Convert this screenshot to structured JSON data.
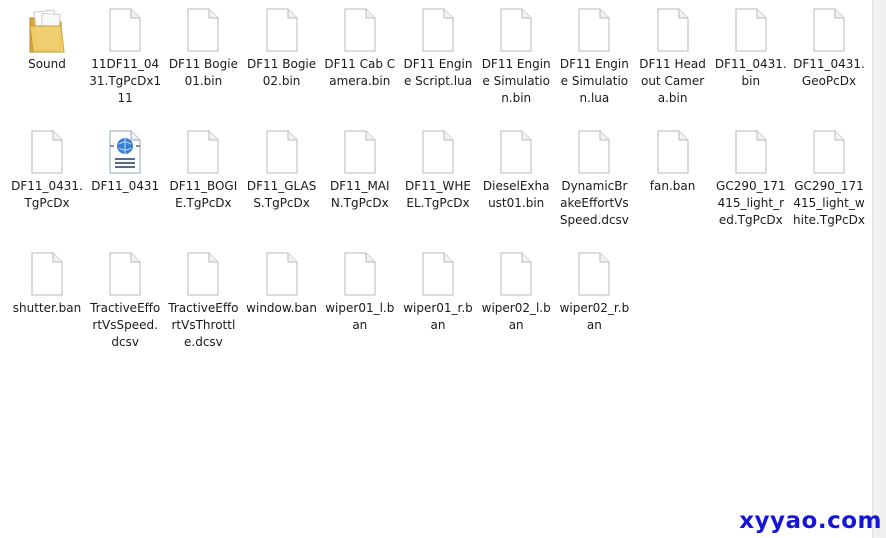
{
  "files": [
    {
      "label": "Sound",
      "type": "folder"
    },
    {
      "label": "11DF11_0431.TgPcDx111",
      "type": "file"
    },
    {
      "label": "DF11 Bogie01.bin",
      "type": "file"
    },
    {
      "label": "DF11 Bogie02.bin",
      "type": "file"
    },
    {
      "label": "DF11 Cab Camera.bin",
      "type": "file"
    },
    {
      "label": "DF11 Engine Script.lua",
      "type": "file"
    },
    {
      "label": "DF11 Engine Simulation.bin",
      "type": "file"
    },
    {
      "label": "DF11 Engine Simulation.lua",
      "type": "file"
    },
    {
      "label": "DF11 Headout Camera.bin",
      "type": "file"
    },
    {
      "label": "DF11_0431.bin",
      "type": "file"
    },
    {
      "label": "DF11_0431.GeoPcDx",
      "type": "file"
    },
    {
      "label": "DF11_0431.TgPcDx",
      "type": "file"
    },
    {
      "label": "DF11_0431",
      "type": "html"
    },
    {
      "label": "DF11_BOGIE.TgPcDx",
      "type": "file"
    },
    {
      "label": "DF11_GLASS.TgPcDx",
      "type": "file"
    },
    {
      "label": "DF11_MAIN.TgPcDx",
      "type": "file"
    },
    {
      "label": "DF11_WHEEL.TgPcDx",
      "type": "file"
    },
    {
      "label": "DieselExhaust01.bin",
      "type": "file"
    },
    {
      "label": "DynamicBrakeEffortVsSpeed.dcsv",
      "type": "file"
    },
    {
      "label": "fan.ban",
      "type": "file"
    },
    {
      "label": "GC290_171415_light_red.TgPcDx",
      "type": "file"
    },
    {
      "label": "GC290_171415_light_white.TgPcDx",
      "type": "file"
    },
    {
      "label": "shutter.ban",
      "type": "file"
    },
    {
      "label": "TractiveEffortVsSpeed.dcsv",
      "type": "file"
    },
    {
      "label": "TractiveEffortVsThrottle.dcsv",
      "type": "file"
    },
    {
      "label": "window.ban",
      "type": "file"
    },
    {
      "label": "wiper01_l.ban",
      "type": "file"
    },
    {
      "label": "wiper01_r.ban",
      "type": "file"
    },
    {
      "label": "wiper02_l.ban",
      "type": "file"
    },
    {
      "label": "wiper02_r.ban",
      "type": "file"
    }
  ],
  "watermark": "xyyao.com",
  "colors": {
    "folder": "#e8c25a",
    "watermark": "#1515d8"
  }
}
